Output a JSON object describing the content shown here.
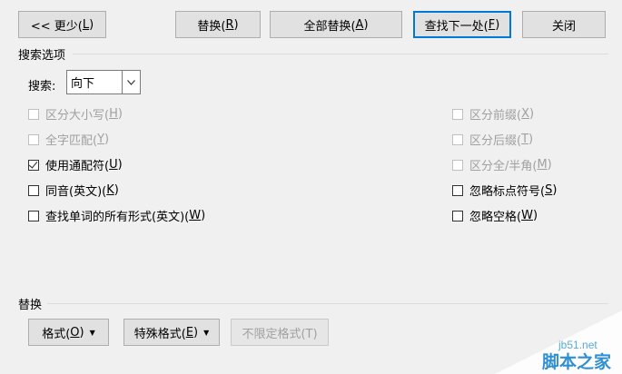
{
  "top_buttons": {
    "less": {
      "prefix": "<< 更少(",
      "key": "L",
      "suffix": ")"
    },
    "replace": {
      "prefix": "替换(",
      "key": "R",
      "suffix": ")"
    },
    "replace_all": {
      "prefix": "全部替换(",
      "key": "A",
      "suffix": ")"
    },
    "find_next": {
      "prefix": "查找下一处(",
      "key": "F",
      "suffix": ")"
    },
    "close": {
      "label": "关闭"
    }
  },
  "search_options": {
    "group_label": "搜索选项",
    "search_label": "搜索:",
    "search_value": "向下",
    "left_checks": [
      {
        "prefix": "区分大小写(",
        "key": "H",
        "suffix": ")",
        "checked": false,
        "disabled": true
      },
      {
        "prefix": "全字匹配(",
        "key": "Y",
        "suffix": ")",
        "checked": false,
        "disabled": true
      },
      {
        "prefix": "使用通配符(",
        "key": "U",
        "suffix": ")",
        "checked": true,
        "disabled": false
      },
      {
        "prefix": "同音(英文)(",
        "key": "K",
        "suffix": ")",
        "checked": false,
        "disabled": false
      },
      {
        "prefix": "查找单词的所有形式(英文)(",
        "key": "W",
        "suffix": ")",
        "checked": false,
        "disabled": false
      }
    ],
    "right_checks": [
      {
        "prefix": "区分前缀(",
        "key": "X",
        "suffix": ")",
        "checked": false,
        "disabled": true
      },
      {
        "prefix": "区分后缀(",
        "key": "T",
        "suffix": ")",
        "checked": false,
        "disabled": true
      },
      {
        "prefix": "区分全/半角(",
        "key": "M",
        "suffix": ")",
        "checked": false,
        "disabled": true
      },
      {
        "prefix": "忽略标点符号(",
        "key": "S",
        "suffix": ")",
        "checked": false,
        "disabled": false
      },
      {
        "prefix": "忽略空格(",
        "key": "W",
        "suffix": ")",
        "checked": false,
        "disabled": false
      }
    ]
  },
  "replace_section": {
    "group_label": "替换",
    "format": {
      "prefix": "格式(",
      "key": "O",
      "suffix": ")"
    },
    "special": {
      "prefix": "特殊格式(",
      "key": "E",
      "suffix": ")"
    },
    "no_format": {
      "label": "不限定格式(T)"
    }
  },
  "watermark": {
    "site": "jb51.net",
    "name": "脚本之家"
  }
}
